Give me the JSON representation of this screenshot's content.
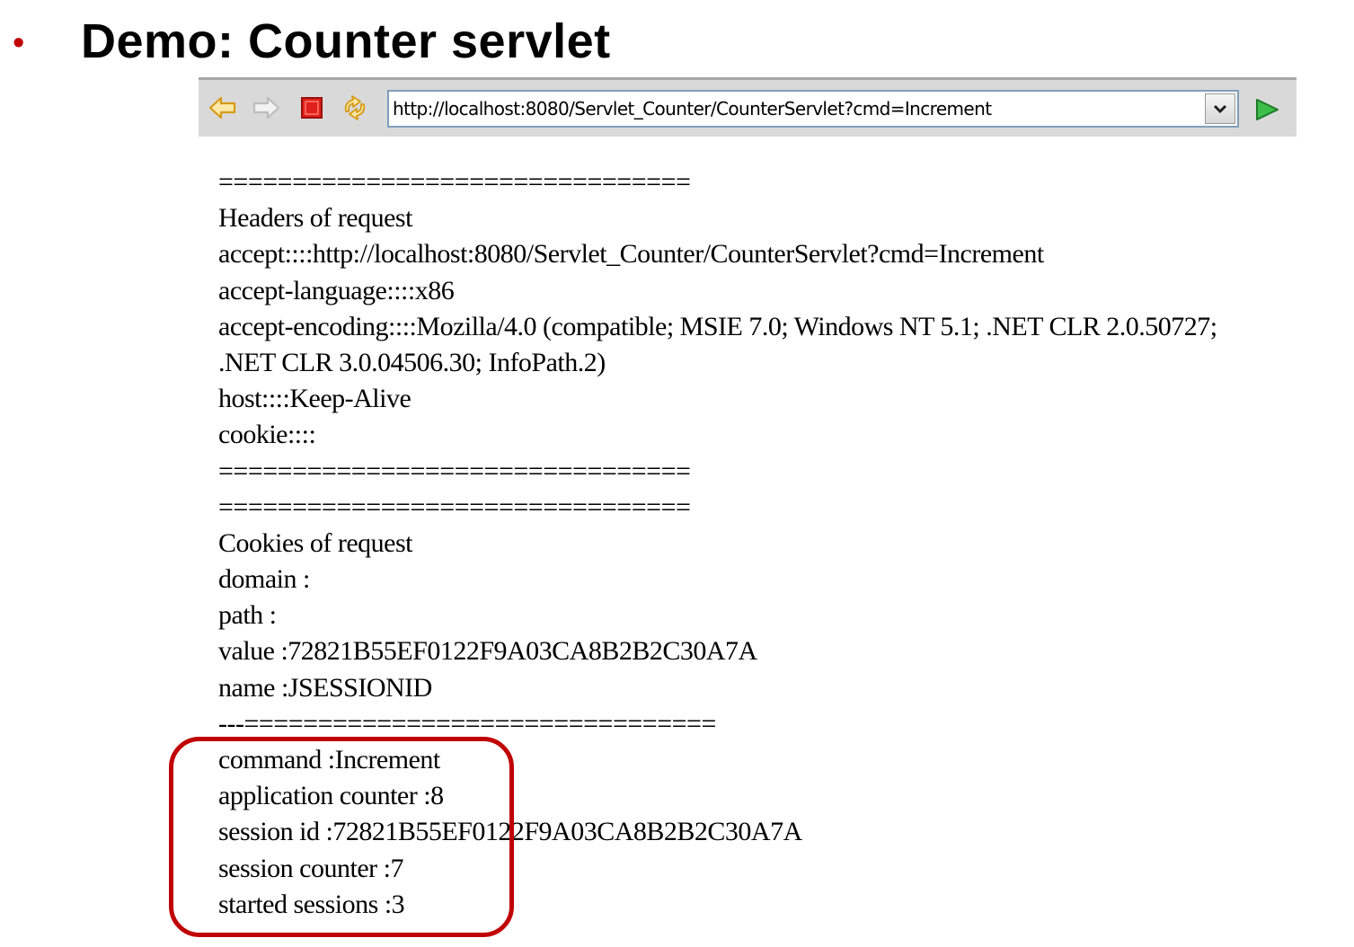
{
  "slide": {
    "bullet": "•",
    "title": "Demo: Counter servlet"
  },
  "browser": {
    "url": "http://localhost:8080/Servlet_Counter/CounterServlet?cmd=Increment",
    "icons": {
      "back": "back-arrow-icon",
      "forward": "forward-arrow-icon",
      "stop": "stop-icon",
      "refresh": "refresh-icon",
      "dropdown": "chevron-down-icon",
      "go": "go-arrow-icon"
    },
    "colors": {
      "toolbar": "#d9d9d9",
      "stop_red": "#e0201b",
      "go_green": "#2aa33a",
      "arrow_yellow": "#f4c232"
    }
  },
  "page": {
    "lines": [
      "================================",
      "Headers of request",
      "accept::::http://localhost:8080/Servlet_Counter/CounterServlet?cmd=Increment",
      "accept-language::::x86",
      "accept-encoding::::Mozilla/4.0 (compatible; MSIE 7.0; Windows NT 5.1; .NET CLR 2.0.50727; .NET CLR 3.0.04506.30; InfoPath.2)",
      "host::::Keep-Alive",
      "cookie::::",
      "================================",
      "================================",
      "Cookies of request",
      "domain :",
      "path :",
      "value :72821B55EF0122F9A03CA8B2B2C30A7A",
      "name :JSESSIONID",
      "---================================",
      "command :Increment",
      "application counter :8",
      "session id :72821B55EF0122F9A03CA8B2B2C30A7A",
      "session counter :7",
      "started sessions :3"
    ]
  },
  "highlight_color": "#c00000"
}
